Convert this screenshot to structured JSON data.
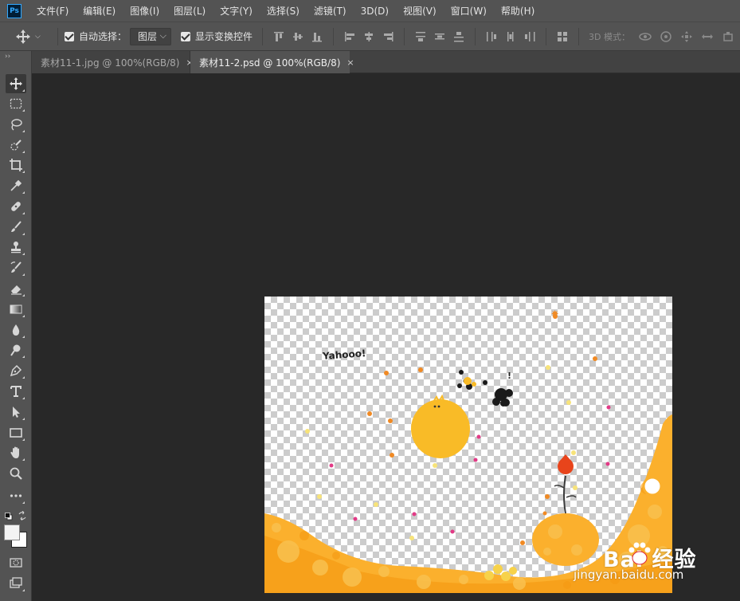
{
  "app": {
    "logo": "Ps"
  },
  "menu": [
    "文件(F)",
    "编辑(E)",
    "图像(I)",
    "图层(L)",
    "文字(Y)",
    "选择(S)",
    "滤镜(T)",
    "3D(D)",
    "视图(V)",
    "窗口(W)",
    "帮助(H)"
  ],
  "options": {
    "auto_select_label": "自动选择：",
    "auto_select_value": "图层",
    "show_transform_label": "显示变换控件",
    "mode_3d_label": "3D 模式："
  },
  "tabs": [
    {
      "label": "素材11-1.jpg @ 100%(RGB/8)",
      "close": "×",
      "active": false
    },
    {
      "label": "素材11-2.psd @ 100%(RGB/8)",
      "close": "×",
      "active": true
    }
  ],
  "tools": [
    "move-tool",
    "marquee-tool",
    "lasso-tool",
    "quick-select-tool",
    "crop-tool",
    "eyedropper-tool",
    "healing-brush-tool",
    "brush-tool",
    "clone-stamp-tool",
    "history-brush-tool",
    "eraser-tool",
    "gradient-tool",
    "blur-tool",
    "dodge-tool",
    "pen-tool",
    "type-tool",
    "path-select-tool",
    "rectangle-tool",
    "hand-tool",
    "zoom-tool",
    "more-tools"
  ],
  "canvas": {
    "text": "Yahooo!",
    "exclaim": "!"
  },
  "watermark": {
    "brand": "Bai  经验",
    "url": "jingyan.baidu.com"
  },
  "colors": {
    "accent": "#31a8ff",
    "orange": "#fbb02d",
    "chrome": "#535353"
  }
}
